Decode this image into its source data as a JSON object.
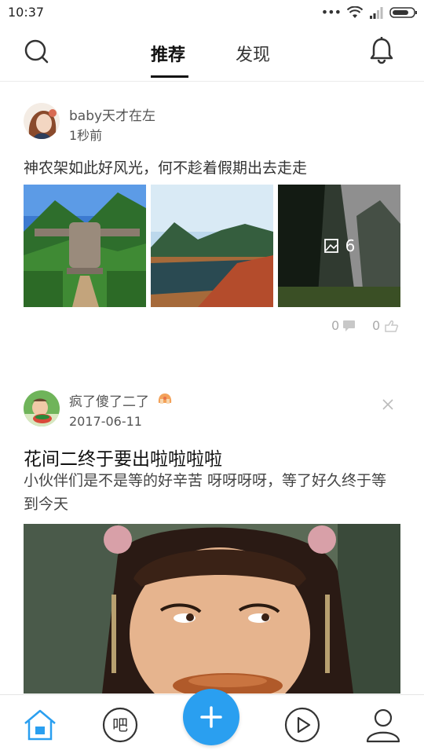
{
  "status_bar": {
    "time": "10:37",
    "dots": "•••",
    "icons": [
      "wifi-icon",
      "signal-icon",
      "battery-icon"
    ]
  },
  "header": {
    "tabs": [
      {
        "label": "推荐",
        "active": true
      },
      {
        "label": "发现",
        "active": false
      }
    ],
    "icons": [
      "search-icon",
      "bell-icon"
    ]
  },
  "feed": {
    "posts": [
      {
        "username": "baby天才在左",
        "time": "1秒前",
        "text": "神农架如此好风光，何不趁着假期出去走走",
        "image_count": "6",
        "comment_count": "0",
        "like_count": "0"
      },
      {
        "username": "疯了傻了二了",
        "time": "2017-06-11",
        "title": "花间二终于要出啦啦啦啦",
        "description": "小伙伴们是不是等的好辛苦 呀呀呀呀，等了好久终于等到今天"
      }
    ]
  },
  "bottom_nav": {
    "ba_label": "吧",
    "items": [
      "home-icon",
      "ba-icon",
      "add-icon",
      "video-icon",
      "profile-icon"
    ]
  },
  "colors": {
    "accent": "#2a9ff0",
    "home_active": "#2a9ff0"
  }
}
